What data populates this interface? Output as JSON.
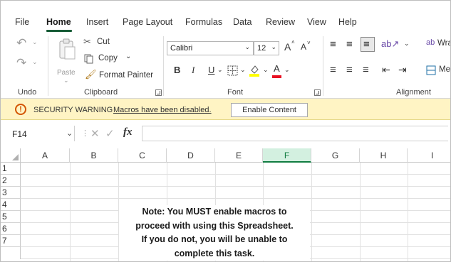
{
  "menu": {
    "tabs": [
      "File",
      "Home",
      "Insert",
      "Page Layout",
      "Formulas",
      "Data",
      "Review",
      "View",
      "Help"
    ],
    "active": "Home"
  },
  "ribbon": {
    "undo": {
      "label": "Undo"
    },
    "clipboard": {
      "label": "Clipboard",
      "paste": "Paste",
      "cut": "Cut",
      "copy": "Copy",
      "format_painter": "Format Painter"
    },
    "font": {
      "label": "Font",
      "family": "Calibri",
      "size": "12",
      "bold": "B",
      "italic": "I",
      "underline": "U",
      "grow": "A",
      "shrink": "A",
      "font_color": "A"
    },
    "alignment": {
      "label": "Alignment",
      "wrap": "Wra",
      "merge": "Me"
    }
  },
  "security": {
    "title": "SECURITY WARNING",
    "message": "Macros have been disabled.",
    "button": "Enable Content"
  },
  "formula_bar": {
    "name_box": "F14",
    "fx": "fx",
    "value": ""
  },
  "grid": {
    "columns": [
      "A",
      "B",
      "C",
      "D",
      "E",
      "F",
      "G",
      "H",
      "I"
    ],
    "selected_column": "F",
    "rows": [
      "1",
      "2",
      "3",
      "4",
      "5",
      "6",
      "7"
    ],
    "note_lines": [
      "Note: You MUST enable macros to",
      "proceed with using this Spreadsheet.",
      "If you do not, you will be unable to",
      "complete this task."
    ]
  },
  "colors": {
    "excel_green": "#107c41",
    "tab_underline": "#185c37",
    "warning_bar": "#fff4c4",
    "warning_icon": "#d35400"
  }
}
